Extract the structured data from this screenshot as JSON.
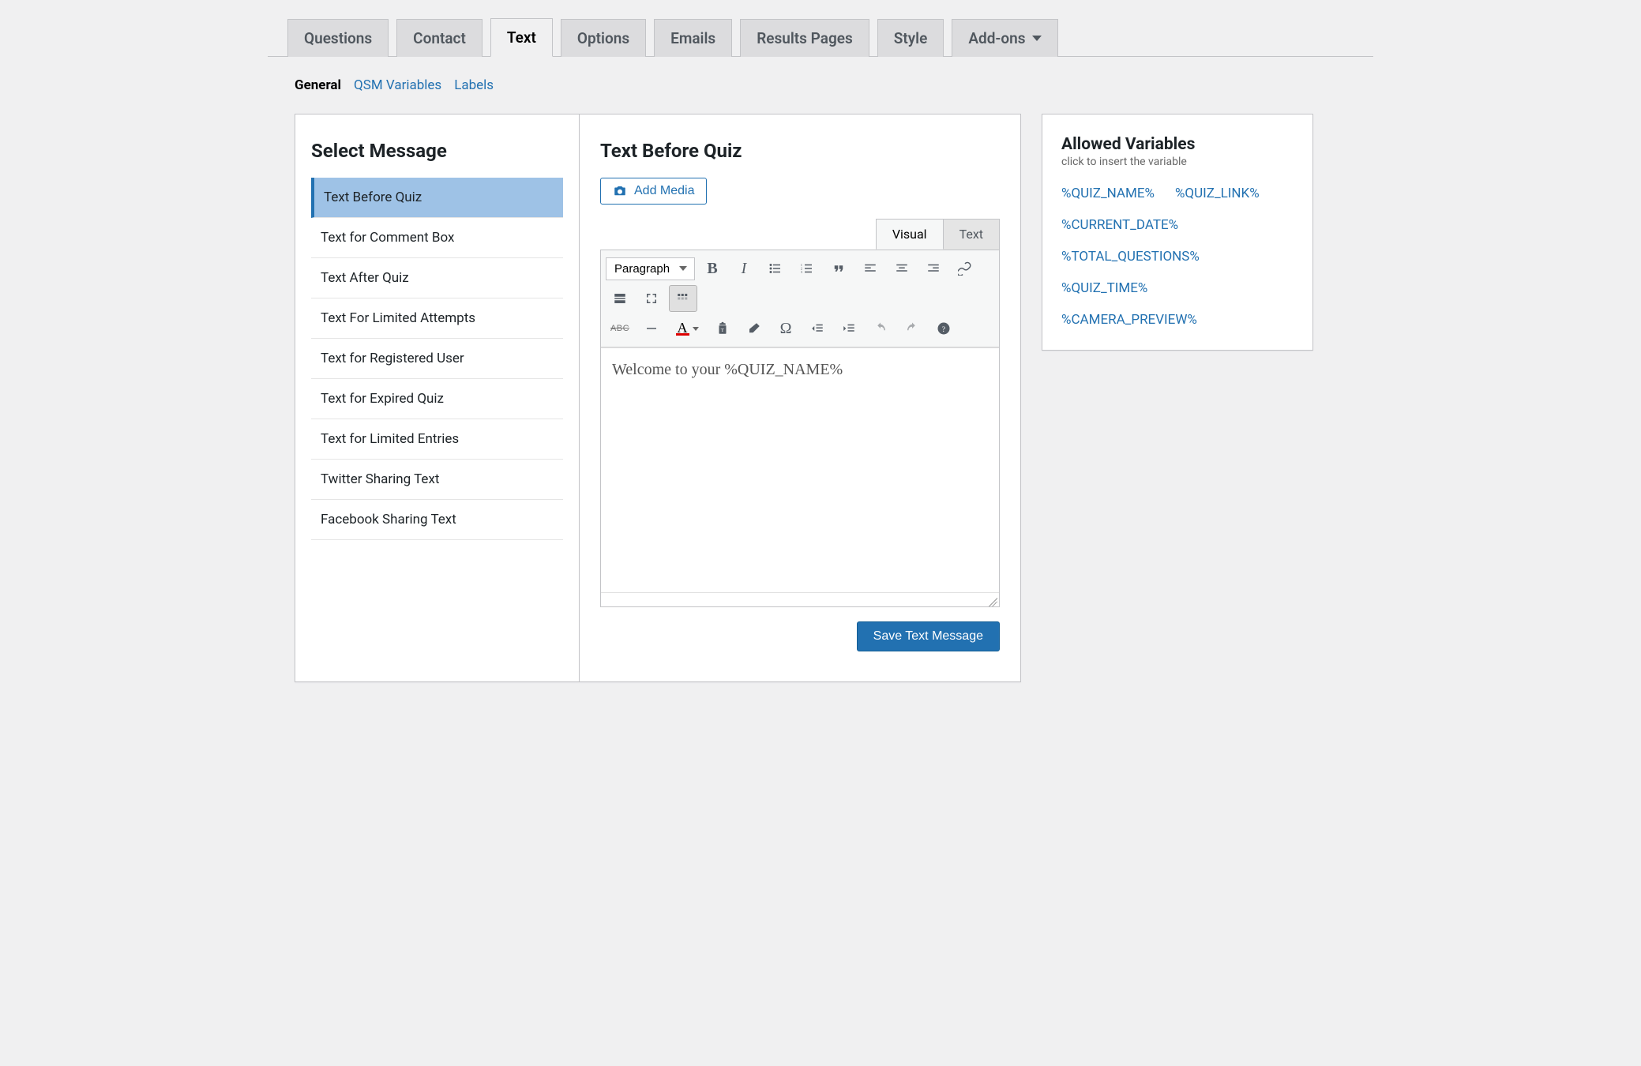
{
  "tabs": {
    "questions": "Questions",
    "contact": "Contact",
    "text": "Text",
    "options": "Options",
    "emails": "Emails",
    "results": "Results Pages",
    "style": "Style",
    "addons": "Add-ons"
  },
  "subnav": {
    "general": "General",
    "qsm_variables": "QSM Variables",
    "labels": "Labels"
  },
  "left": {
    "title": "Select Message",
    "items": [
      "Text Before Quiz",
      "Text for Comment Box",
      "Text After Quiz",
      "Text For Limited Attempts",
      "Text for Registered User",
      "Text for Expired Quiz",
      "Text for Limited Entries",
      "Twitter Sharing Text",
      "Facebook Sharing Text"
    ]
  },
  "editor": {
    "title": "Text Before Quiz",
    "add_media": "Add Media",
    "tabs": {
      "visual": "Visual",
      "text": "Text"
    },
    "format_select": "Paragraph",
    "content": "Welcome to your %QUIZ_NAME%",
    "save_button": "Save Text Message"
  },
  "vars": {
    "title": "Allowed Variables",
    "subtitle": "click to insert the variable",
    "items": [
      "%QUIZ_NAME%",
      "%QUIZ_LINK%",
      "%CURRENT_DATE%",
      "%TOTAL_QUESTIONS%",
      "%QUIZ_TIME%",
      "%CAMERA_PREVIEW%"
    ]
  }
}
